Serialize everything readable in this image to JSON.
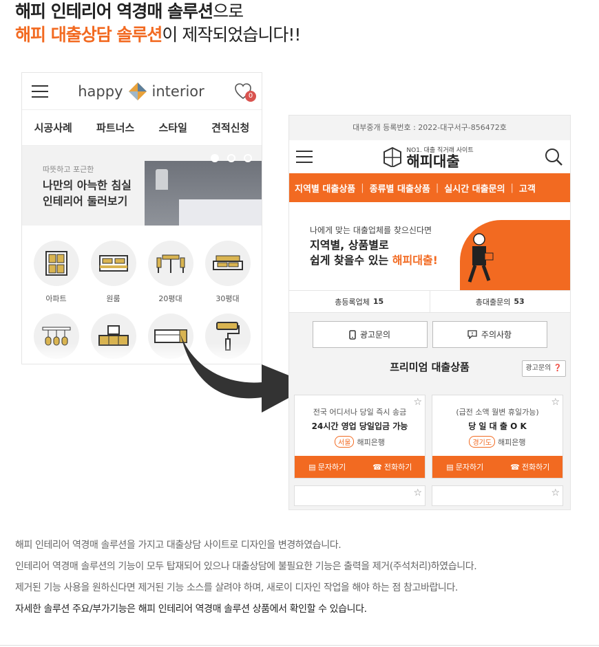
{
  "headline": {
    "line1_bold": "해피 인테리어 역경매 솔루션",
    "line1_rest": "으로",
    "line2_orange": "해피 대출상담 솔루션",
    "line2_rest": "이 제작되었습니다!!"
  },
  "left_phone": {
    "logo_happy": "happy",
    "logo_interior": "interior",
    "cart_badge": "0",
    "nav": [
      "시공사례",
      "파트너스",
      "스타일",
      "견적신청"
    ],
    "banner_small": "따뜻하고 포근한",
    "banner_line1": "나만의 아늑한 침실",
    "banner_line2": "인테리어 둘러보기",
    "categories": [
      {
        "label": "아파트",
        "icon": "apartment-icon"
      },
      {
        "label": "원룸",
        "icon": "bed-icon"
      },
      {
        "label": "20평대",
        "icon": "table-chairs-icon"
      },
      {
        "label": "30평대",
        "icon": "sofa-icon"
      },
      {
        "label": "",
        "icon": "pendant-lamp-icon"
      },
      {
        "label": "",
        "icon": "tv-stand-icon"
      },
      {
        "label": "",
        "icon": "drawer-icon"
      },
      {
        "label": "",
        "icon": "paint-roller-icon"
      }
    ],
    "accent": "#d9b451"
  },
  "right_phone": {
    "reg_number": "대부중개 등록번호 : 2022-대구서구-856472호",
    "logo_small": "NO1. 대출 직거래 사이트",
    "logo_big": "해피대출",
    "menu": [
      "지역별 대출상품",
      "종류별 대출상품",
      "실시간 대출문의",
      "고객"
    ],
    "hero_small": "나에게 맞는 대출업체를 찾으신다면",
    "hero_line1": "지역별, 상품별로",
    "hero_line2_a": "쉽게 찾을수 있는 ",
    "hero_line2_b": "해피대출!",
    "stats": [
      {
        "label": "총등록업체",
        "value": "15"
      },
      {
        "label": "총대출문의",
        "value": "53"
      }
    ],
    "btn_ad": "광고문의",
    "btn_notice": "주의사항",
    "section_title": "프리미엄 대출상품",
    "section_ad": "광고문의",
    "cards": [
      {
        "line1": "전국 어디서나 당일 즉시 송금",
        "line2": "24시간 영업 당일입금 가능",
        "region": "서울",
        "company": "해피은행",
        "sms": "문자하기",
        "call": "전화하기"
      },
      {
        "line1": "(급전 소액 월변 휴일가능)",
        "line2": "당 일 대 출 O K",
        "region": "경기도",
        "company": "해피은행",
        "sms": "문자하기",
        "call": "전화하기"
      }
    ],
    "brand_color": "#f26a21"
  },
  "description": {
    "line1": "해피 인테리어 역경매 솔루션을 가지고 대출상담 사이트로 디자인을 변경하였습니다.",
    "line2": "인테리어 역경매 솔루션의 기능이 모두 탑재되어 있으나 대출상담에 불필요한 기능은 출력을 제거(주석처리)하였습니다.",
    "line3": "제거된 기능 사용을 원하신다면 제거된 기능 소스를 살려야 하며, 새로이 디자인 작업을 해야 하는 점 참고바랍니다.",
    "line4": "자세한 솔루션 주요/부가기능은 해피 인테리어 역경매 솔루션 상품에서 확인할 수 있습니다."
  }
}
